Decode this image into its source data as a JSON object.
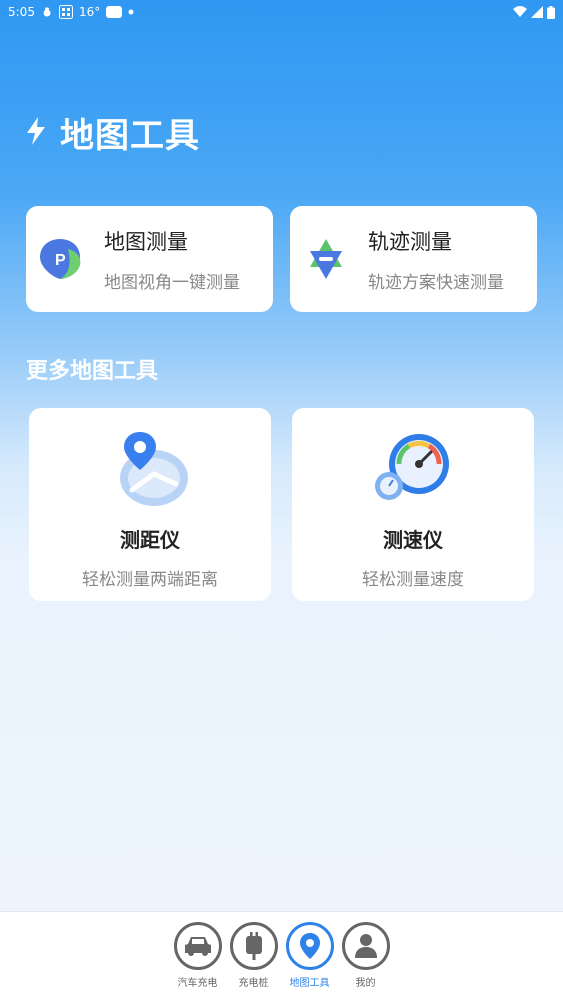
{
  "status_bar": {
    "time": "5:05",
    "temp": "16°"
  },
  "header": {
    "title": "地图工具"
  },
  "top_cards": [
    {
      "title": "地图测量",
      "desc": "地图视角一键测量"
    },
    {
      "title": "轨迹测量",
      "desc": "轨迹方案快速测量"
    }
  ],
  "section": {
    "title": "更多地图工具"
  },
  "tools": [
    {
      "title": "测距仪",
      "desc": "轻松测量两端距离"
    },
    {
      "title": "测速仪",
      "desc": "轻松测量速度"
    }
  ],
  "nav": [
    {
      "label": "汽车充电",
      "icon": "car-icon"
    },
    {
      "label": "充电桩",
      "icon": "charger-icon"
    },
    {
      "label": "地图工具",
      "icon": "location-icon",
      "active": true
    },
    {
      "label": "我的",
      "icon": "person-icon"
    }
  ],
  "colors": {
    "accent": "#2f82e8",
    "bg_top": "#2f98f2"
  }
}
